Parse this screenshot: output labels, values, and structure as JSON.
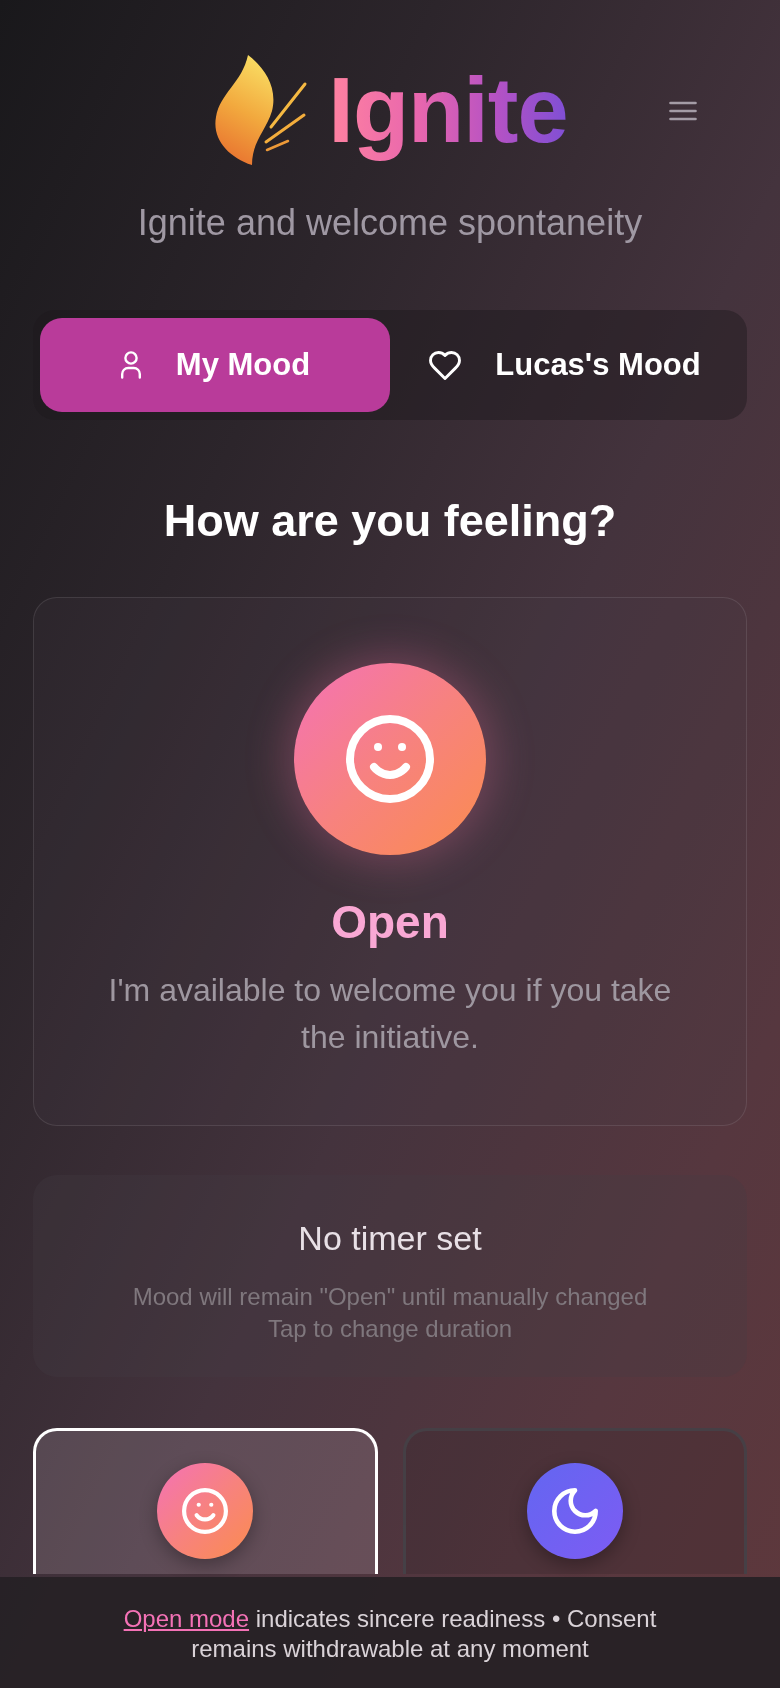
{
  "header": {
    "wordmark": "Ignite",
    "tagline": "Ignite and welcome spontaneity"
  },
  "tabs": [
    {
      "label": "My Mood",
      "kind": "self",
      "selected": true
    },
    {
      "label": "Lucas's Mood",
      "kind": "partner",
      "selected": false
    }
  ],
  "prompt": "How are you feeling?",
  "current_mood": {
    "kind": "smile",
    "name": "Open",
    "description": "I'm available to welcome you if you take the initiative."
  },
  "timer": {
    "title": "No timer set",
    "note": "Mood will remain \"Open\" until manually changed",
    "hint": "Tap to change duration"
  },
  "mood_options": [
    {
      "kind": "smile",
      "selected": true
    },
    {
      "kind": "moon",
      "selected": false
    }
  ],
  "footer_note": {
    "link": "Open mode",
    "text": "indicates sincere readiness • Consent remains withdrawable at any moment"
  }
}
